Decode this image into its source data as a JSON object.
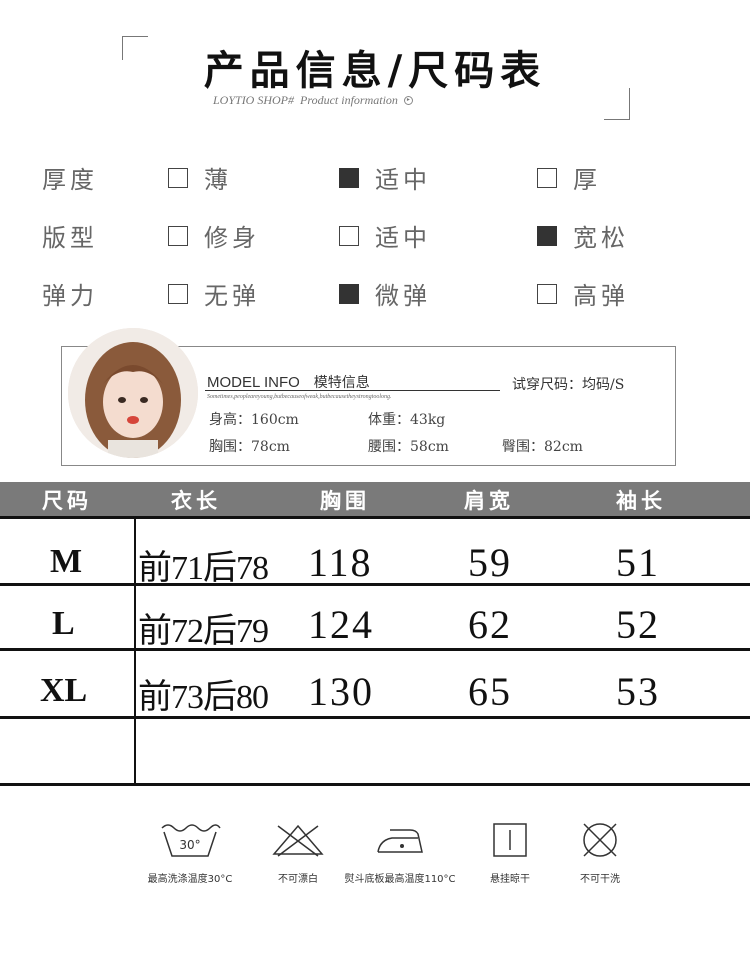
{
  "header": {
    "title": "产品信息/尺码表",
    "subtitle_brand": "LOYTIO SHOP#",
    "subtitle_text": "Product information"
  },
  "attributes": [
    {
      "label": "厚度",
      "options": [
        {
          "text": "薄",
          "checked": false
        },
        {
          "text": "适中",
          "checked": true
        },
        {
          "text": "厚",
          "checked": false
        }
      ]
    },
    {
      "label": "版型",
      "options": [
        {
          "text": "修身",
          "checked": false
        },
        {
          "text": "适中",
          "checked": false
        },
        {
          "text": "宽松",
          "checked": true
        }
      ]
    },
    {
      "label": "弹力",
      "options": [
        {
          "text": "无弹",
          "checked": false
        },
        {
          "text": "微弹",
          "checked": true
        },
        {
          "text": "高弹",
          "checked": false
        }
      ]
    }
  ],
  "model": {
    "title_en": "MODEL INFO",
    "title_cn": "模特信息",
    "small_text": "Sometimes,peopleareyoung,butbecauseofweak,butbecausetheystrongtoolong.",
    "try_size_label": "试穿尺码：均码/S",
    "height": "身高：160cm",
    "weight": "体重：43kg",
    "bust": "胸围：78cm",
    "waist": "腰围：58cm",
    "hip": "臀围：82cm"
  },
  "size_table": {
    "headers": [
      "尺码",
      "衣长",
      "胸围",
      "肩宽",
      "袖长"
    ],
    "rows": [
      {
        "size": "M",
        "length": "前71后78",
        "bust": "118",
        "shoulder": "59",
        "sleeve": "51"
      },
      {
        "size": "L",
        "length": "前72后79",
        "bust": "124",
        "shoulder": "62",
        "sleeve": "52"
      },
      {
        "size": "XL",
        "length": "前73后80",
        "bust": "130",
        "shoulder": "65",
        "sleeve": "53"
      }
    ]
  },
  "care": [
    {
      "icon": "wash-30-icon",
      "label": "最高洗涤温度30°C",
      "symbol": "30°"
    },
    {
      "icon": "no-bleach-icon",
      "label": "不可漂白"
    },
    {
      "icon": "iron-icon",
      "label": "熨斗底板最高温度110°C"
    },
    {
      "icon": "hang-dry-icon",
      "label": "悬挂晾干"
    },
    {
      "icon": "no-dry-clean-icon",
      "label": "不可干洗"
    }
  ]
}
